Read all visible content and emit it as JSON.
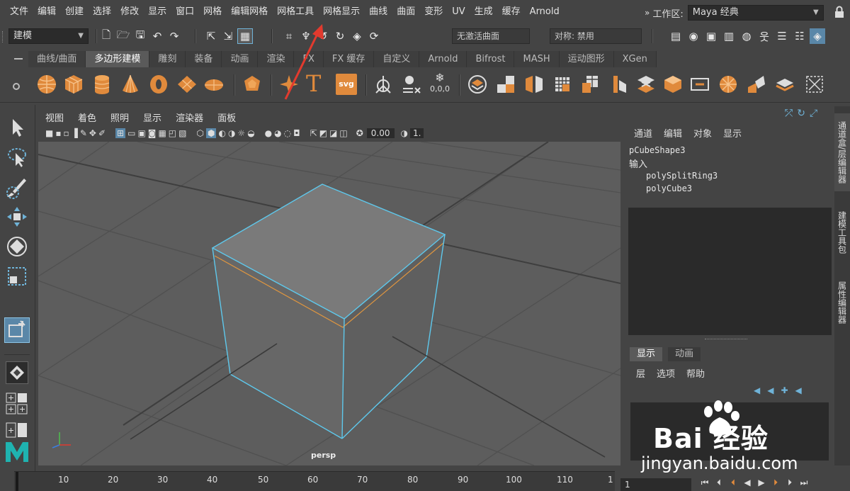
{
  "menubar": {
    "items": [
      "文件",
      "编辑",
      "创建",
      "选择",
      "修改",
      "显示",
      "窗口",
      "网格",
      "编辑网格",
      "网格工具",
      "网格显示",
      "曲线",
      "曲面",
      "变形",
      "UV",
      "生成",
      "缓存",
      "Arnold"
    ],
    "workspace_label": "工作区:",
    "workspace_value": "Maya 经典"
  },
  "statusline": {
    "mode": "建模",
    "live_surface": "无激活曲面",
    "symmetry": "对称: 禁用"
  },
  "shelf": {
    "tabs": [
      "曲线/曲面",
      "多边形建模",
      "雕刻",
      "装备",
      "动画",
      "渲染",
      "FX",
      "FX 缓存",
      "自定义",
      "Arnold",
      "Bifrost",
      "MASH",
      "运动图形",
      "XGen"
    ],
    "active_tab": "多边形建模",
    "svg_label": "svg",
    "text_tool": "T",
    "coord_label": "0,0,0"
  },
  "viewport": {
    "menu": [
      "视图",
      "着色",
      "照明",
      "显示",
      "渲染器",
      "面板"
    ],
    "camera": "persp",
    "value_field": "0.00",
    "value_field2": "1."
  },
  "channel_box": {
    "menu": [
      "通道",
      "编辑",
      "对象",
      "显示"
    ],
    "shape": "pCubeShape3",
    "inputs_label": "输入",
    "inputs": [
      "polySplitRing3",
      "polyCube3"
    ]
  },
  "layer_editor": {
    "tabs": [
      "显示",
      "动画"
    ],
    "active_tab": "显示",
    "menu": [
      "层",
      "选项",
      "帮助"
    ]
  },
  "side_tabs": [
    "通道盒/层编辑器",
    "建模工具包",
    "属性编辑器"
  ],
  "timeline": {
    "ticks": [
      "10",
      "20",
      "30",
      "40",
      "50",
      "60",
      "70",
      "80",
      "90",
      "100",
      "110",
      "1"
    ],
    "current_frame": "1"
  },
  "watermark": {
    "brand": "Bai 经验",
    "url": "jingyan.baidu.com"
  },
  "colors": {
    "accent_orange": "#e08a3c",
    "selection_blue": "#5ec8ec",
    "edge_orange": "#e0963f",
    "annotation_red": "#e23a2e"
  }
}
